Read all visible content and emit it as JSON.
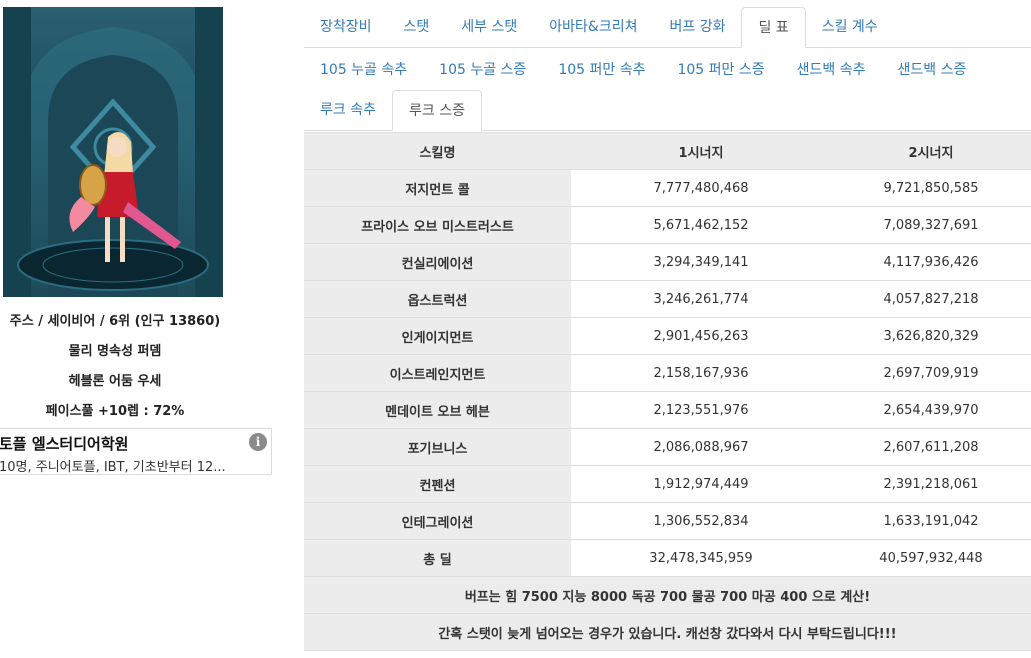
{
  "profile": {
    "line1": "주스 / 세이비어 / 6위 (인구 13860)",
    "line2": "물리 명속성 퍼뎀",
    "line3": "헤블론 어둠 우세",
    "line4": "페이스풀 +10렙 : 72%"
  },
  "ad": {
    "title": "토플 엘스터디어학원",
    "desc": "10명, 주니어토플, IBT, 기초반부터 12...",
    "info_icon": "i"
  },
  "tabs_row1": [
    "장착장비",
    "스탯",
    "세부 스탯",
    "아바타&크리쳐",
    "버프 강화",
    "딜 표",
    "스킬 계수"
  ],
  "tabs_row1_active": "딜 표",
  "tabs_row2": [
    "105 누골 속추",
    "105 누골 스증",
    "105 퍼만 속추",
    "105 퍼만 스증",
    "샌드백 속추",
    "샌드백 스증"
  ],
  "tabs_row3": [
    "루크 속추",
    "루크 스증"
  ],
  "tabs_row3_active": "루크 스증",
  "table": {
    "headers": [
      "스킬명",
      "1시너지",
      "2시너지"
    ],
    "rows": [
      [
        "저지먼트 콜",
        "7,777,480,468",
        "9,721,850,585"
      ],
      [
        "프라이스 오브 미스트러스트",
        "5,671,462,152",
        "7,089,327,691"
      ],
      [
        "컨실리에이션",
        "3,294,349,141",
        "4,117,936,426"
      ],
      [
        "옵스트럭션",
        "3,246,261,774",
        "4,057,827,218"
      ],
      [
        "인게이지먼트",
        "2,901,456,263",
        "3,626,820,329"
      ],
      [
        "이스트레인지먼트",
        "2,158,167,936",
        "2,697,709,919"
      ],
      [
        "멘데이트 오브 헤븐",
        "2,123,551,976",
        "2,654,439,970"
      ],
      [
        "포기브니스",
        "2,086,088,967",
        "2,607,611,208"
      ],
      [
        "컨펜션",
        "1,912,974,449",
        "2,391,218,061"
      ],
      [
        "인테그레이션",
        "1,306,552,834",
        "1,633,191,042"
      ],
      [
        "총 딜",
        "32,478,345,959",
        "40,597,932,448"
      ]
    ],
    "notes": [
      "버프는 힘 7500 지능 8000 독공 700 물공 700 마공 400 으로 계산!",
      "간혹 스탯이 늦게 넘어오는 경우가 있습니다. 캐선창 갔다와서 다시 부탁드립니다!!!"
    ]
  },
  "colors": {
    "link": "#337ab7",
    "header_bg": "#ececec",
    "border": "#dddddd"
  }
}
